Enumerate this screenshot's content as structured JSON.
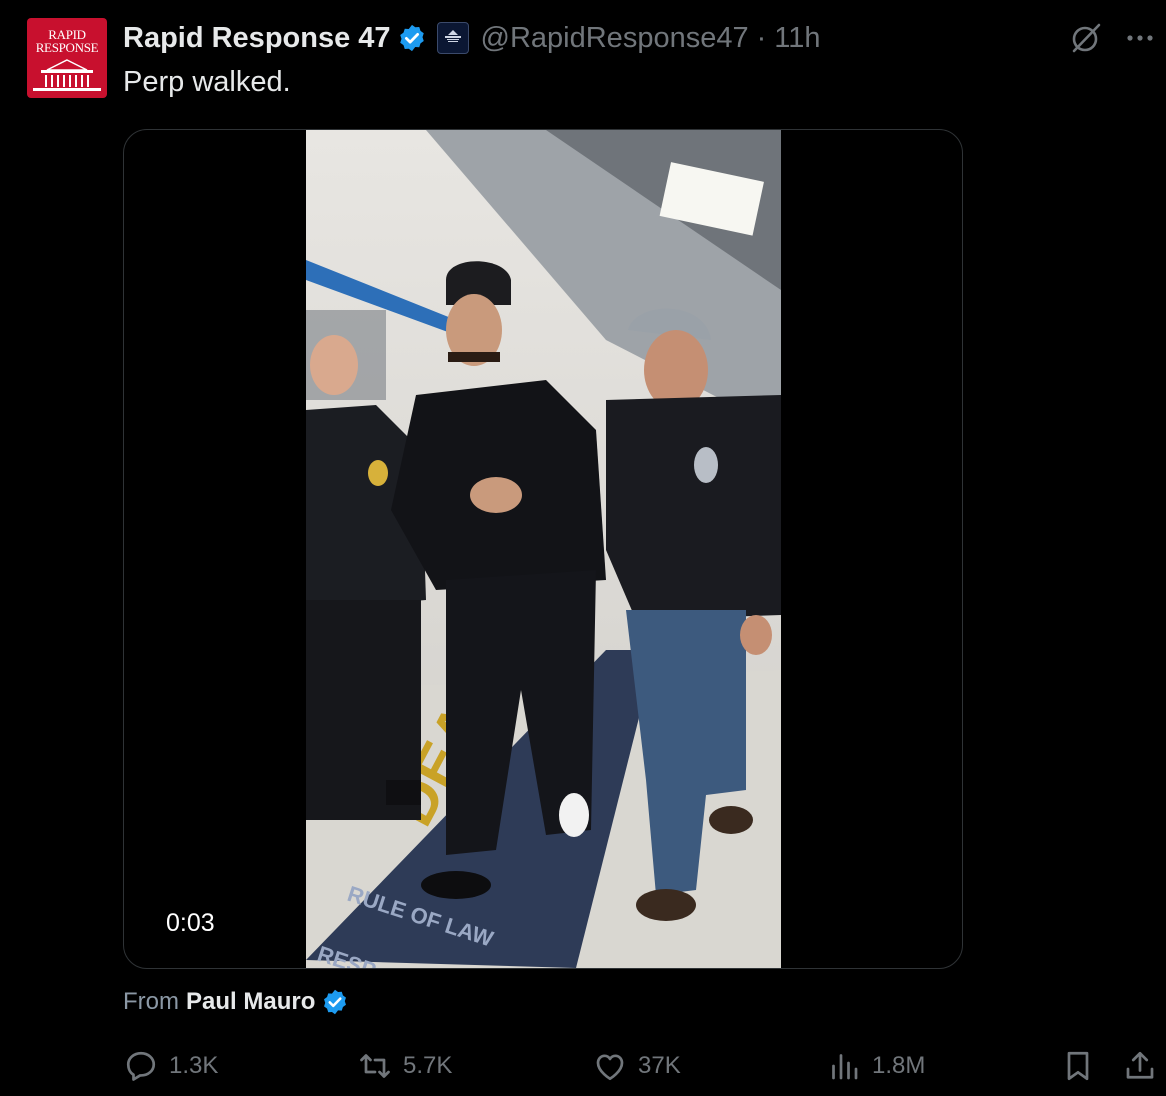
{
  "author": {
    "display_name": "Rapid Response 47",
    "handle": "@RapidResponse47",
    "separator": "·",
    "time": "11h",
    "avatar_text_line1": "RAPID",
    "avatar_text_line2": "RESPONSE",
    "avatar_color": "#c8102e",
    "verified_color": "#1d9bf0"
  },
  "tweet": {
    "text": "Perp walked."
  },
  "media": {
    "type": "video",
    "duration": "0:03",
    "mat_texts": [
      "DEA",
      "RULE OF LAW",
      "RESP"
    ]
  },
  "attribution": {
    "from_label": "From",
    "from_name": "Paul Mauro"
  },
  "actions": {
    "replies": "1.3K",
    "reposts": "5.7K",
    "likes": "37K",
    "views": "1.8M"
  },
  "icons": [
    "verified-icon",
    "grok-icon",
    "more-icon",
    "reply-icon",
    "repost-icon",
    "like-icon",
    "views-icon",
    "bookmark-icon",
    "share-icon"
  ]
}
